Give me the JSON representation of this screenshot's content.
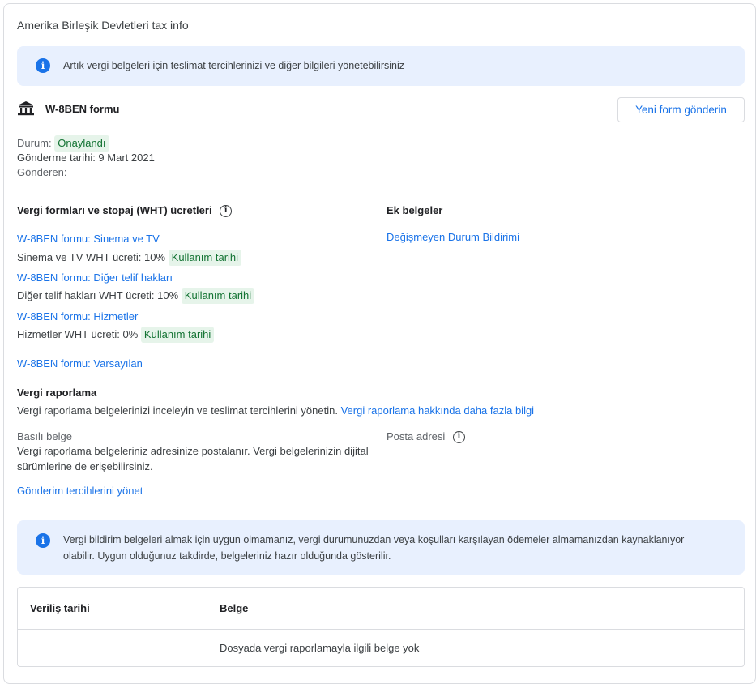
{
  "card": {
    "title": "Amerika Birleşik Devletleri tax info"
  },
  "banner_top": {
    "text": "Artık vergi belgeleri için teslimat tercihlerinizi ve diğer bilgileri yönetebilirsiniz"
  },
  "form": {
    "title": "W-8BEN formu",
    "new_form_button": "Yeni form gönderin",
    "status_label": "Durum:",
    "status_value": "Onaylandı",
    "date_line": "Gönderme tarihi: 9 Mart 2021",
    "sender_label": "Gönderen:"
  },
  "wht": {
    "heading": "Vergi formları ve stopaj (WHT) ücretleri",
    "items": [
      {
        "link": "W-8BEN formu: Sinema ve TV",
        "rate": "Sinema ve TV WHT ücreti: 10%",
        "chip": "Kullanım tarihi"
      },
      {
        "link": "W-8BEN formu: Diğer telif hakları",
        "rate": "Diğer telif hakları WHT ücreti: 10%",
        "chip": "Kullanım tarihi"
      },
      {
        "link": "W-8BEN formu: Hizmetler",
        "rate": "Hizmetler WHT ücreti: 0%",
        "chip": "Kullanım tarihi"
      }
    ],
    "default_link": "W-8BEN formu: Varsayılan"
  },
  "extra_docs": {
    "heading": "Ek belgeler",
    "link": "Değişmeyen Durum Bildirimi"
  },
  "reporting": {
    "heading": "Vergi raporlama",
    "desc": "Vergi raporlama belgelerinizi inceleyin ve teslimat tercihlerini yönetin.",
    "more_link": "Vergi raporlama hakkında daha fazla bilgi",
    "printed_label": "Basılı belge",
    "printed_desc_1": "Vergi raporlama belgeleriniz adresinize postalanır. Vergi belgelerinizin dijital",
    "printed_desc_2": "sürümlerine de erişebilirsiniz.",
    "postal_label": "Posta adresi",
    "manage_link": "Gönderim tercihlerini yönet"
  },
  "banner_bottom": {
    "line1": "Vergi bildirim belgeleri almak için uygun olmamanız, vergi durumunuzdan veya koşulları karşılayan ödemeler almamanızdan kaynaklanıyor",
    "line2": "olabilir. Uygun olduğunuz takdirde, belgeleriniz hazır olduğunda gösterilir."
  },
  "table": {
    "columns": [
      "Veriliş tarihi",
      "Belge"
    ],
    "empty_text": "Dosyada vergi raporlamayla ilgili belge yok"
  }
}
